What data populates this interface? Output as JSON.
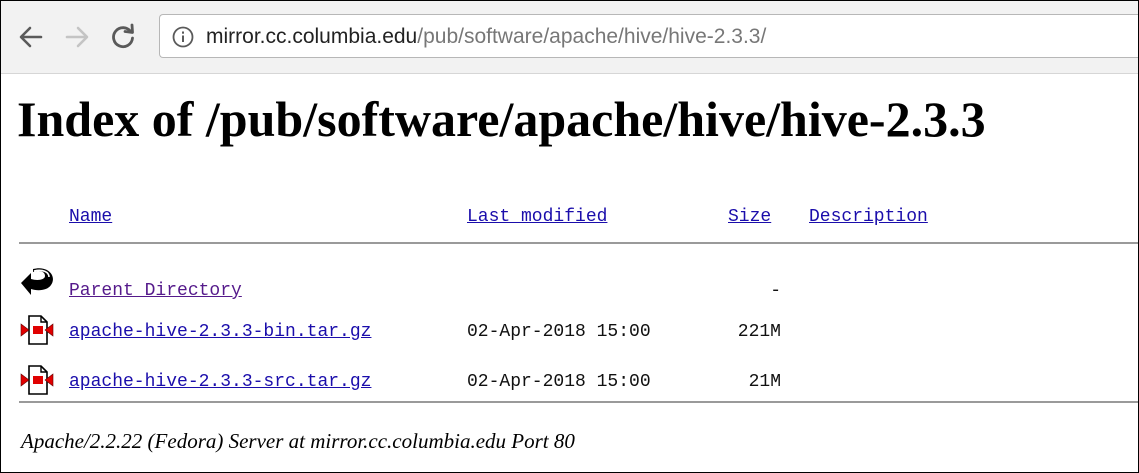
{
  "browser": {
    "address": {
      "host": "mirror.cc.columbia.edu",
      "path": "/pub/software/apache/hive/hive-2.3.3/"
    },
    "icons": {
      "back": "back-arrow-icon",
      "forward": "forward-arrow-icon",
      "reload": "reload-icon",
      "info": "info-icon"
    }
  },
  "page": {
    "title": "Index of /pub/software/apache/hive/hive-2.3.3",
    "columns": {
      "name": "Name",
      "last_modified": "Last modified",
      "size": "Size",
      "description": "Description"
    },
    "entries": [
      {
        "name": "Parent Directory",
        "last_modified": "",
        "size": "-",
        "description": "",
        "icon": "parent-directory-icon"
      },
      {
        "name": "apache-hive-2.3.3-bin.tar.gz",
        "last_modified": "02-Apr-2018 15:00",
        "size": "221M",
        "description": "",
        "icon": "compressed-file-icon"
      },
      {
        "name": "apache-hive-2.3.3-src.tar.gz",
        "last_modified": "02-Apr-2018 15:00",
        "size": "21M",
        "description": "",
        "icon": "compressed-file-icon"
      }
    ],
    "footer": "Apache/2.2.22 (Fedora) Server at mirror.cc.columbia.edu Port 80"
  },
  "colors": {
    "link": "#1a0dab",
    "visited_link": "#551a8b",
    "toolbar_bg": "#f2f2f2",
    "rule": "#9a9a9a"
  }
}
